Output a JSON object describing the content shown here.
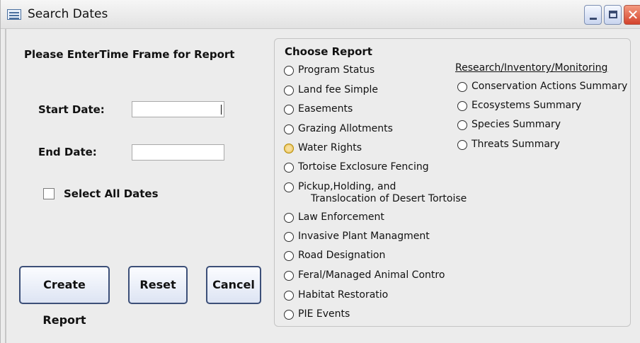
{
  "window": {
    "title": "Search Dates",
    "close_glyph": "✕"
  },
  "form": {
    "heading": "Please EnterTime Frame for Report",
    "start_date_label": "Start Date:",
    "start_date_value": "",
    "end_date_label": "End Date:",
    "end_date_value": "",
    "select_all_label": "Select All Dates",
    "select_all_checked": false
  },
  "buttons": {
    "create": "Create Report",
    "reset": "Reset",
    "cancel": "Cancel"
  },
  "report": {
    "heading": "Choose Report",
    "options": [
      "Program Status",
      "Land fee Simple",
      "Easements",
      "Grazing Allotments",
      "Water Rights",
      "Tortoise Exclosure Fencing",
      "Pickup,Holding, and",
      "Translocation of Desert Tortoise",
      "Law Enforcement",
      "Invasive Plant Managment",
      "Road Designation",
      "Feral/Managed Animal Contro",
      "Habitat Restoratio",
      "PIE Events"
    ],
    "highlighted_option": "Water Rights",
    "research_heading": "Research/Inventory/Monitoring",
    "research_options": [
      "Conservation Actions Summary",
      "Ecosystems Summary",
      "Species Summary",
      "Threats Summary"
    ]
  },
  "icons": {
    "window": "form-icon",
    "minimize": "minimize-icon",
    "maximize": "maximize-icon",
    "close": "close-icon"
  }
}
